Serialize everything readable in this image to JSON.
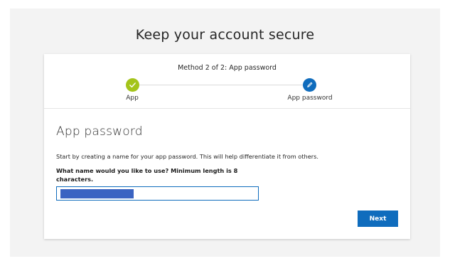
{
  "page": {
    "title": "Keep your account secure"
  },
  "card": {
    "method": "Method 2 of 2: App password",
    "steps": [
      {
        "label": "App",
        "state": "completed",
        "icon": "checkmark-icon",
        "color": "#a4c41a"
      },
      {
        "label": "App password",
        "state": "current",
        "icon": "pencil-icon",
        "color": "#0f6cbd"
      }
    ],
    "section_title": "App password",
    "description": "Start by creating a name for your app password. This will help differentiate it from others.",
    "question": "What name would you like to use? Minimum length is 8 characters.",
    "input": {
      "value": "",
      "redacted": true
    },
    "next_label": "Next"
  },
  "colors": {
    "accent": "#0f6cbd",
    "success": "#a4c41a",
    "background": "#f3f3f3"
  }
}
